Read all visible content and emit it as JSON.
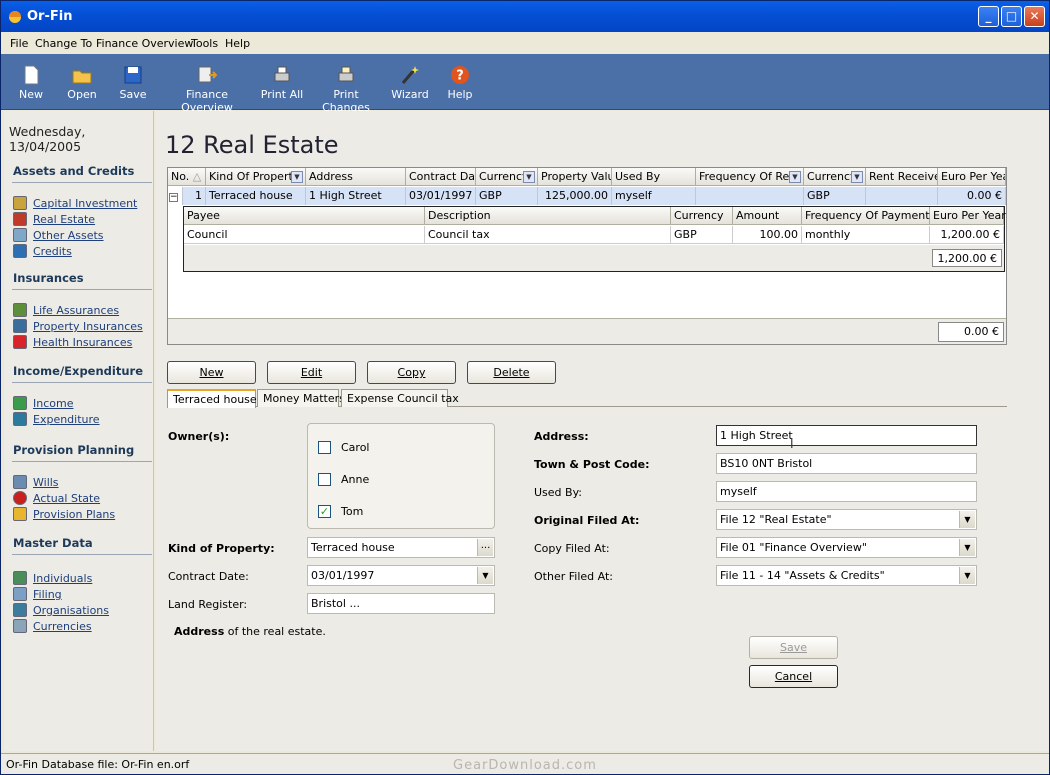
{
  "window": {
    "title": "Or-Fin"
  },
  "menu": [
    "File",
    "Change To",
    "Finance Overview",
    "Tools",
    "Help"
  ],
  "toolbar": [
    {
      "label": "New",
      "icon": "new-document-icon"
    },
    {
      "label": "Open",
      "icon": "open-folder-icon"
    },
    {
      "label": "Save",
      "icon": "save-disk-icon"
    },
    {
      "label": "Finance Overview",
      "icon": "finance-overview-icon"
    },
    {
      "label": "Print All",
      "icon": "printer-icon"
    },
    {
      "label": "Print Changes",
      "icon": "print-changes-icon"
    },
    {
      "label": "Wizard",
      "icon": "magic-wand-icon"
    },
    {
      "label": "Help",
      "icon": "help-icon"
    }
  ],
  "sidebar": {
    "date": "Wednesday, 13/04/2005",
    "sections": [
      {
        "title": "Assets and Credits",
        "items": [
          "Capital Investment",
          "Real Estate",
          "Other Assets",
          "Credits"
        ]
      },
      {
        "title": "Insurances",
        "items": [
          "Life Assurances",
          "Property Insurances",
          "Health Insurances"
        ]
      },
      {
        "title": "Income/Expenditure",
        "items": [
          "Income",
          "Expenditure"
        ]
      },
      {
        "title": "Provision Planning",
        "items": [
          "Wills",
          "Actual State",
          "Provision Plans"
        ]
      },
      {
        "title": "Master Data",
        "items": [
          "Individuals",
          "Filing",
          "Organisations",
          "Currencies"
        ]
      }
    ]
  },
  "main": {
    "heading": "12 Real Estate",
    "grid": {
      "headers": [
        "No.",
        "Kind Of Property",
        "Address",
        "Contract Date",
        "Currency",
        "Property Value",
        "Used By",
        "Frequency Of Rent",
        "Currency",
        "Rent Received",
        "Euro Per Year"
      ],
      "row": {
        "expander": "−",
        "no": "1",
        "kind": "Terraced house",
        "address": "1 High Street",
        "contract_date": "03/01/1997",
        "currency": "GBP",
        "property_value": "125,000.00",
        "used_by": "myself",
        "frequency": "",
        "currency2": "GBP",
        "rent_received": "",
        "euro_per_year": "0.00 €"
      },
      "subgrid": {
        "headers": [
          "Payee",
          "Description",
          "Currency",
          "Amount",
          "Frequency Of Payment",
          "Euro Per Year"
        ],
        "row": {
          "payee": "Council",
          "description": "Council tax",
          "currency": "GBP",
          "amount": "100.00",
          "frequency": "monthly",
          "euro_per_year": "1,200.00 €"
        },
        "total": "1,200.00 €"
      },
      "total": "0.00 €"
    },
    "buttons": {
      "new": "New",
      "edit": "Edit",
      "copy": "Copy",
      "delete": "Delete"
    },
    "tabs": [
      "Terraced house",
      "Money Matters",
      "Expense Council tax"
    ],
    "form": {
      "owners_label": "Owner(s):",
      "owners": [
        {
          "name": "Carol",
          "checked": false
        },
        {
          "name": "Anne",
          "checked": false
        },
        {
          "name": "Tom",
          "checked": true
        }
      ],
      "kind_label": "Kind of Property:",
      "kind_value": "Terraced house",
      "kind_button": "...",
      "contract_label": "Contract Date:",
      "contract_value": "03/01/1997",
      "land_label": "Land Register:",
      "land_value": "Bristol ...",
      "address_label": "Address:",
      "address_value": "1 High Street",
      "town_label": "Town & Post Code:",
      "town_value": "BS10 0NT Bristol",
      "usedby_label": "Used By:",
      "usedby_value": "myself",
      "original_label": "Original Filed At:",
      "original_value": "File 12 \"Real Estate\"",
      "copy_label": "Copy Filed At:",
      "copy_value": "File 01 \"Finance Overview\"",
      "other_label": "Other Filed At:",
      "other_value": "File 11 - 14 \"Assets & Credits\"",
      "hint_bold": "Address",
      "hint_rest": " of the real estate.",
      "save": "Save",
      "cancel": "Cancel"
    }
  },
  "status": "Or-Fin Database file: Or-Fin en.orf",
  "watermark": "GearDownload.com"
}
